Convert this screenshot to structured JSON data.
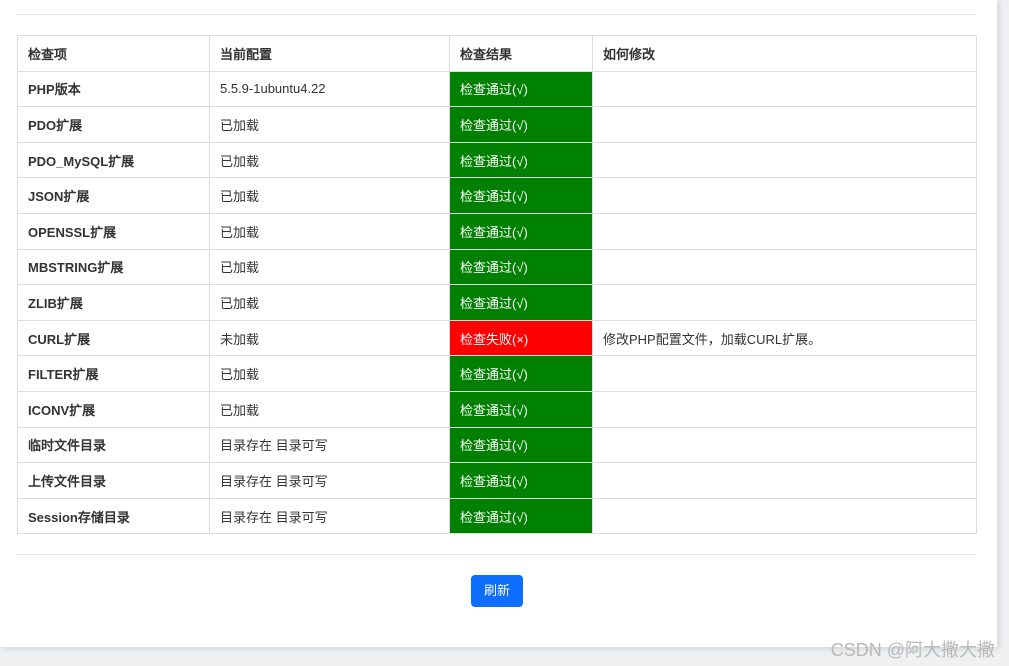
{
  "table": {
    "headers": [
      "检查项",
      "当前配置",
      "检查结果",
      "如何修改"
    ],
    "rows": [
      {
        "item": "PHP版本",
        "config": "5.5.9-1ubuntu4.22",
        "result": "检查通过(√)",
        "status": "pass",
        "fix": ""
      },
      {
        "item": "PDO扩展",
        "config": "已加载",
        "result": "检查通过(√)",
        "status": "pass",
        "fix": ""
      },
      {
        "item": "PDO_MySQL扩展",
        "config": "已加载",
        "result": "检查通过(√)",
        "status": "pass",
        "fix": ""
      },
      {
        "item": "JSON扩展",
        "config": "已加载",
        "result": "检查通过(√)",
        "status": "pass",
        "fix": ""
      },
      {
        "item": "OPENSSL扩展",
        "config": "已加载",
        "result": "检查通过(√)",
        "status": "pass",
        "fix": ""
      },
      {
        "item": "MBSTRING扩展",
        "config": "已加载",
        "result": "检查通过(√)",
        "status": "pass",
        "fix": ""
      },
      {
        "item": "ZLIB扩展",
        "config": "已加载",
        "result": "检查通过(√)",
        "status": "pass",
        "fix": ""
      },
      {
        "item": "CURL扩展",
        "config": "未加载",
        "result": "检查失败(×)",
        "status": "fail",
        "fix": "修改PHP配置文件，加载CURL扩展。"
      },
      {
        "item": "FILTER扩展",
        "config": "已加载",
        "result": "检查通过(√)",
        "status": "pass",
        "fix": ""
      },
      {
        "item": "ICONV扩展",
        "config": "已加载",
        "result": "检查通过(√)",
        "status": "pass",
        "fix": ""
      },
      {
        "item": "临时文件目录",
        "config": "目录存在 目录可写",
        "result": "检查通过(√)",
        "status": "pass",
        "fix": ""
      },
      {
        "item": "上传文件目录",
        "config": "目录存在 目录可写",
        "result": "检查通过(√)",
        "status": "pass",
        "fix": ""
      },
      {
        "item": "Session存储目录",
        "config": "目录存在 目录可写",
        "result": "检查通过(√)",
        "status": "pass",
        "fix": ""
      }
    ]
  },
  "actions": {
    "refresh_label": "刷新"
  },
  "watermark": "CSDN @阿大撒大撒",
  "colors": {
    "pass": "#008000",
    "fail": "#ff0000",
    "button": "#0d6efd"
  }
}
